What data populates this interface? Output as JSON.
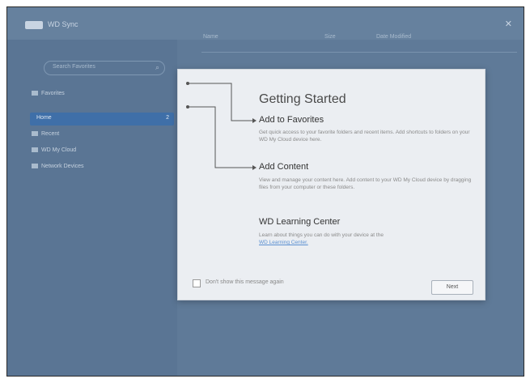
{
  "window": {
    "app_title": "WD Sync",
    "close_glyph": "✕"
  },
  "sidebar": {
    "search_placeholder": "Search Favorites",
    "items": [
      {
        "label": "Favorites"
      },
      {
        "label": "Recent"
      },
      {
        "label": "WD My Cloud"
      },
      {
        "label": "Network Devices"
      }
    ],
    "selected": {
      "label": "Home",
      "count": "2"
    }
  },
  "toolbar": {
    "items": [
      "Name",
      "Size",
      "Date Modified"
    ]
  },
  "dialog": {
    "title": "Getting Started",
    "sections": [
      {
        "heading": "Add to Favorites",
        "body": "Get quick access to your favorite folders and recent items. Add shortcuts to folders on your WD My Cloud device here."
      },
      {
        "heading": "Add Content",
        "body": "View and manage your content here. Add content to your WD My Cloud device by dragging files from your computer or these folders."
      },
      {
        "heading": "WD Learning Center",
        "body": "Learn about things you can do with your device at the",
        "link": "WD Learning Center."
      }
    ],
    "dont_show_label": "Don't show this message again",
    "next_label": "Next"
  }
}
